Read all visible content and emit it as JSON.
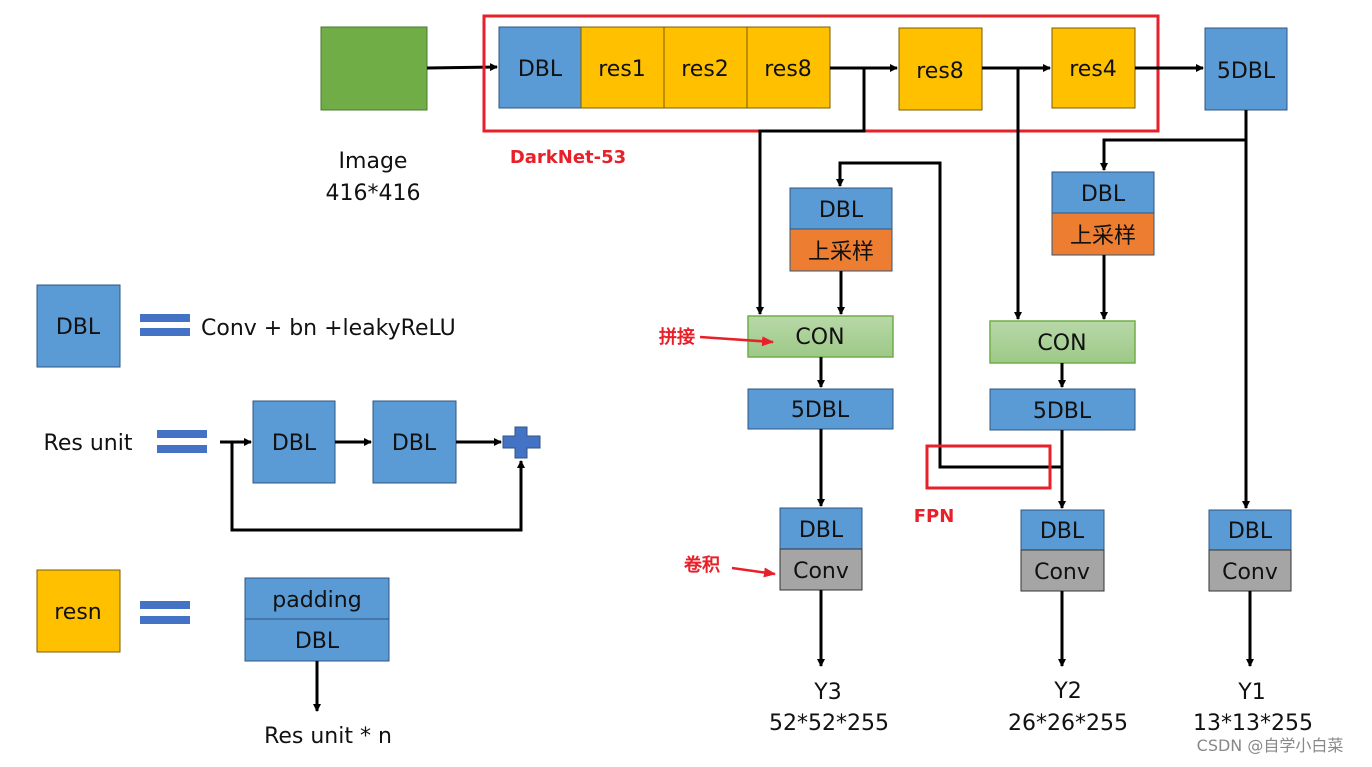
{
  "input": {
    "label": "Image",
    "size": "416*416"
  },
  "backbone": {
    "title": "DarkNet-53",
    "blocks": [
      "DBL",
      "res1",
      "res2",
      "res8",
      "res8",
      "res4"
    ]
  },
  "neck": {
    "top": "5DBL",
    "dbl": "DBL",
    "upsample": "上采样",
    "concat": "CON",
    "five_dbl": "5DBL",
    "conv": "Conv",
    "fpn_label": "FPN"
  },
  "annotations": {
    "concat": "拼接",
    "conv": "卷积"
  },
  "outputs": [
    {
      "name": "Y3",
      "shape": "52*52*255"
    },
    {
      "name": "Y2",
      "shape": "26*26*255"
    },
    {
      "name": "Y1",
      "shape": "13*13*255"
    }
  ],
  "legend": {
    "dbl": {
      "box": "DBL",
      "def": "Conv + bn +leakyReLU"
    },
    "res_unit": {
      "label": "Res unit",
      "a": "DBL",
      "b": "DBL"
    },
    "resn": {
      "box": "resn",
      "top": "padding",
      "bottom": "DBL",
      "caption": "Res unit * n"
    }
  },
  "watermark": "CSDN @自学小白菜",
  "colors": {
    "dbl": "#5B9BD5",
    "res": "#FFC000",
    "upsample": "#ED7D31",
    "concat": "#A9D18E",
    "conv": "#A5A5A5",
    "image": "#70AD47",
    "highlight": "#E8202A"
  }
}
